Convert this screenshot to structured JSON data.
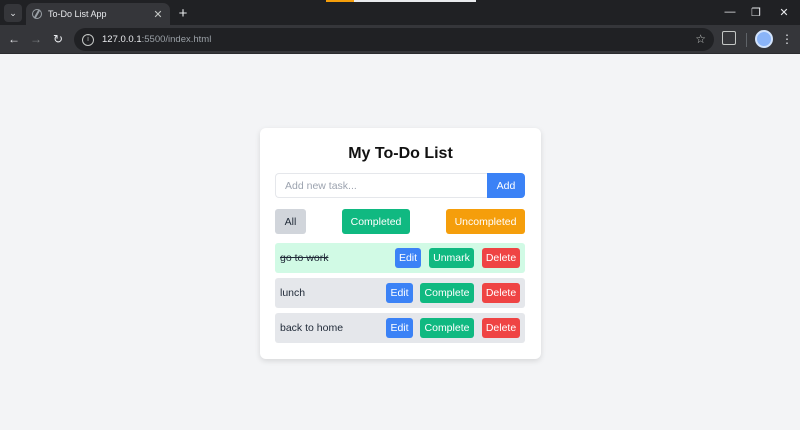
{
  "browser": {
    "tab_title": "To-Do List App",
    "tab_close": "✕",
    "new_tab": "+",
    "url_host": "127.0.0.1",
    "url_path": ":5500/index.html",
    "window_controls": {
      "minimize": "—",
      "restore": "❐",
      "close": "✕"
    }
  },
  "app": {
    "title": "My To-Do List",
    "input_placeholder": "Add new task...",
    "input_value": "",
    "add_label": "Add",
    "filters": {
      "all": "All",
      "completed": "Completed",
      "uncompleted": "Uncompleted"
    },
    "tasks": [
      {
        "text": "go to work",
        "completed": true,
        "edit": "Edit",
        "toggle": "Unmark",
        "delete": "Delete"
      },
      {
        "text": "lunch",
        "completed": false,
        "edit": "Edit",
        "toggle": "Complete",
        "delete": "Delete"
      },
      {
        "text": "back to home",
        "completed": false,
        "edit": "Edit",
        "toggle": "Complete",
        "delete": "Delete"
      }
    ]
  },
  "colors": {
    "primary": "#3b82f6",
    "success": "#10b981",
    "warning": "#f59e0b",
    "danger": "#ef4444",
    "completed_row": "#d1fae5",
    "pending_row": "#e5e7eb"
  }
}
